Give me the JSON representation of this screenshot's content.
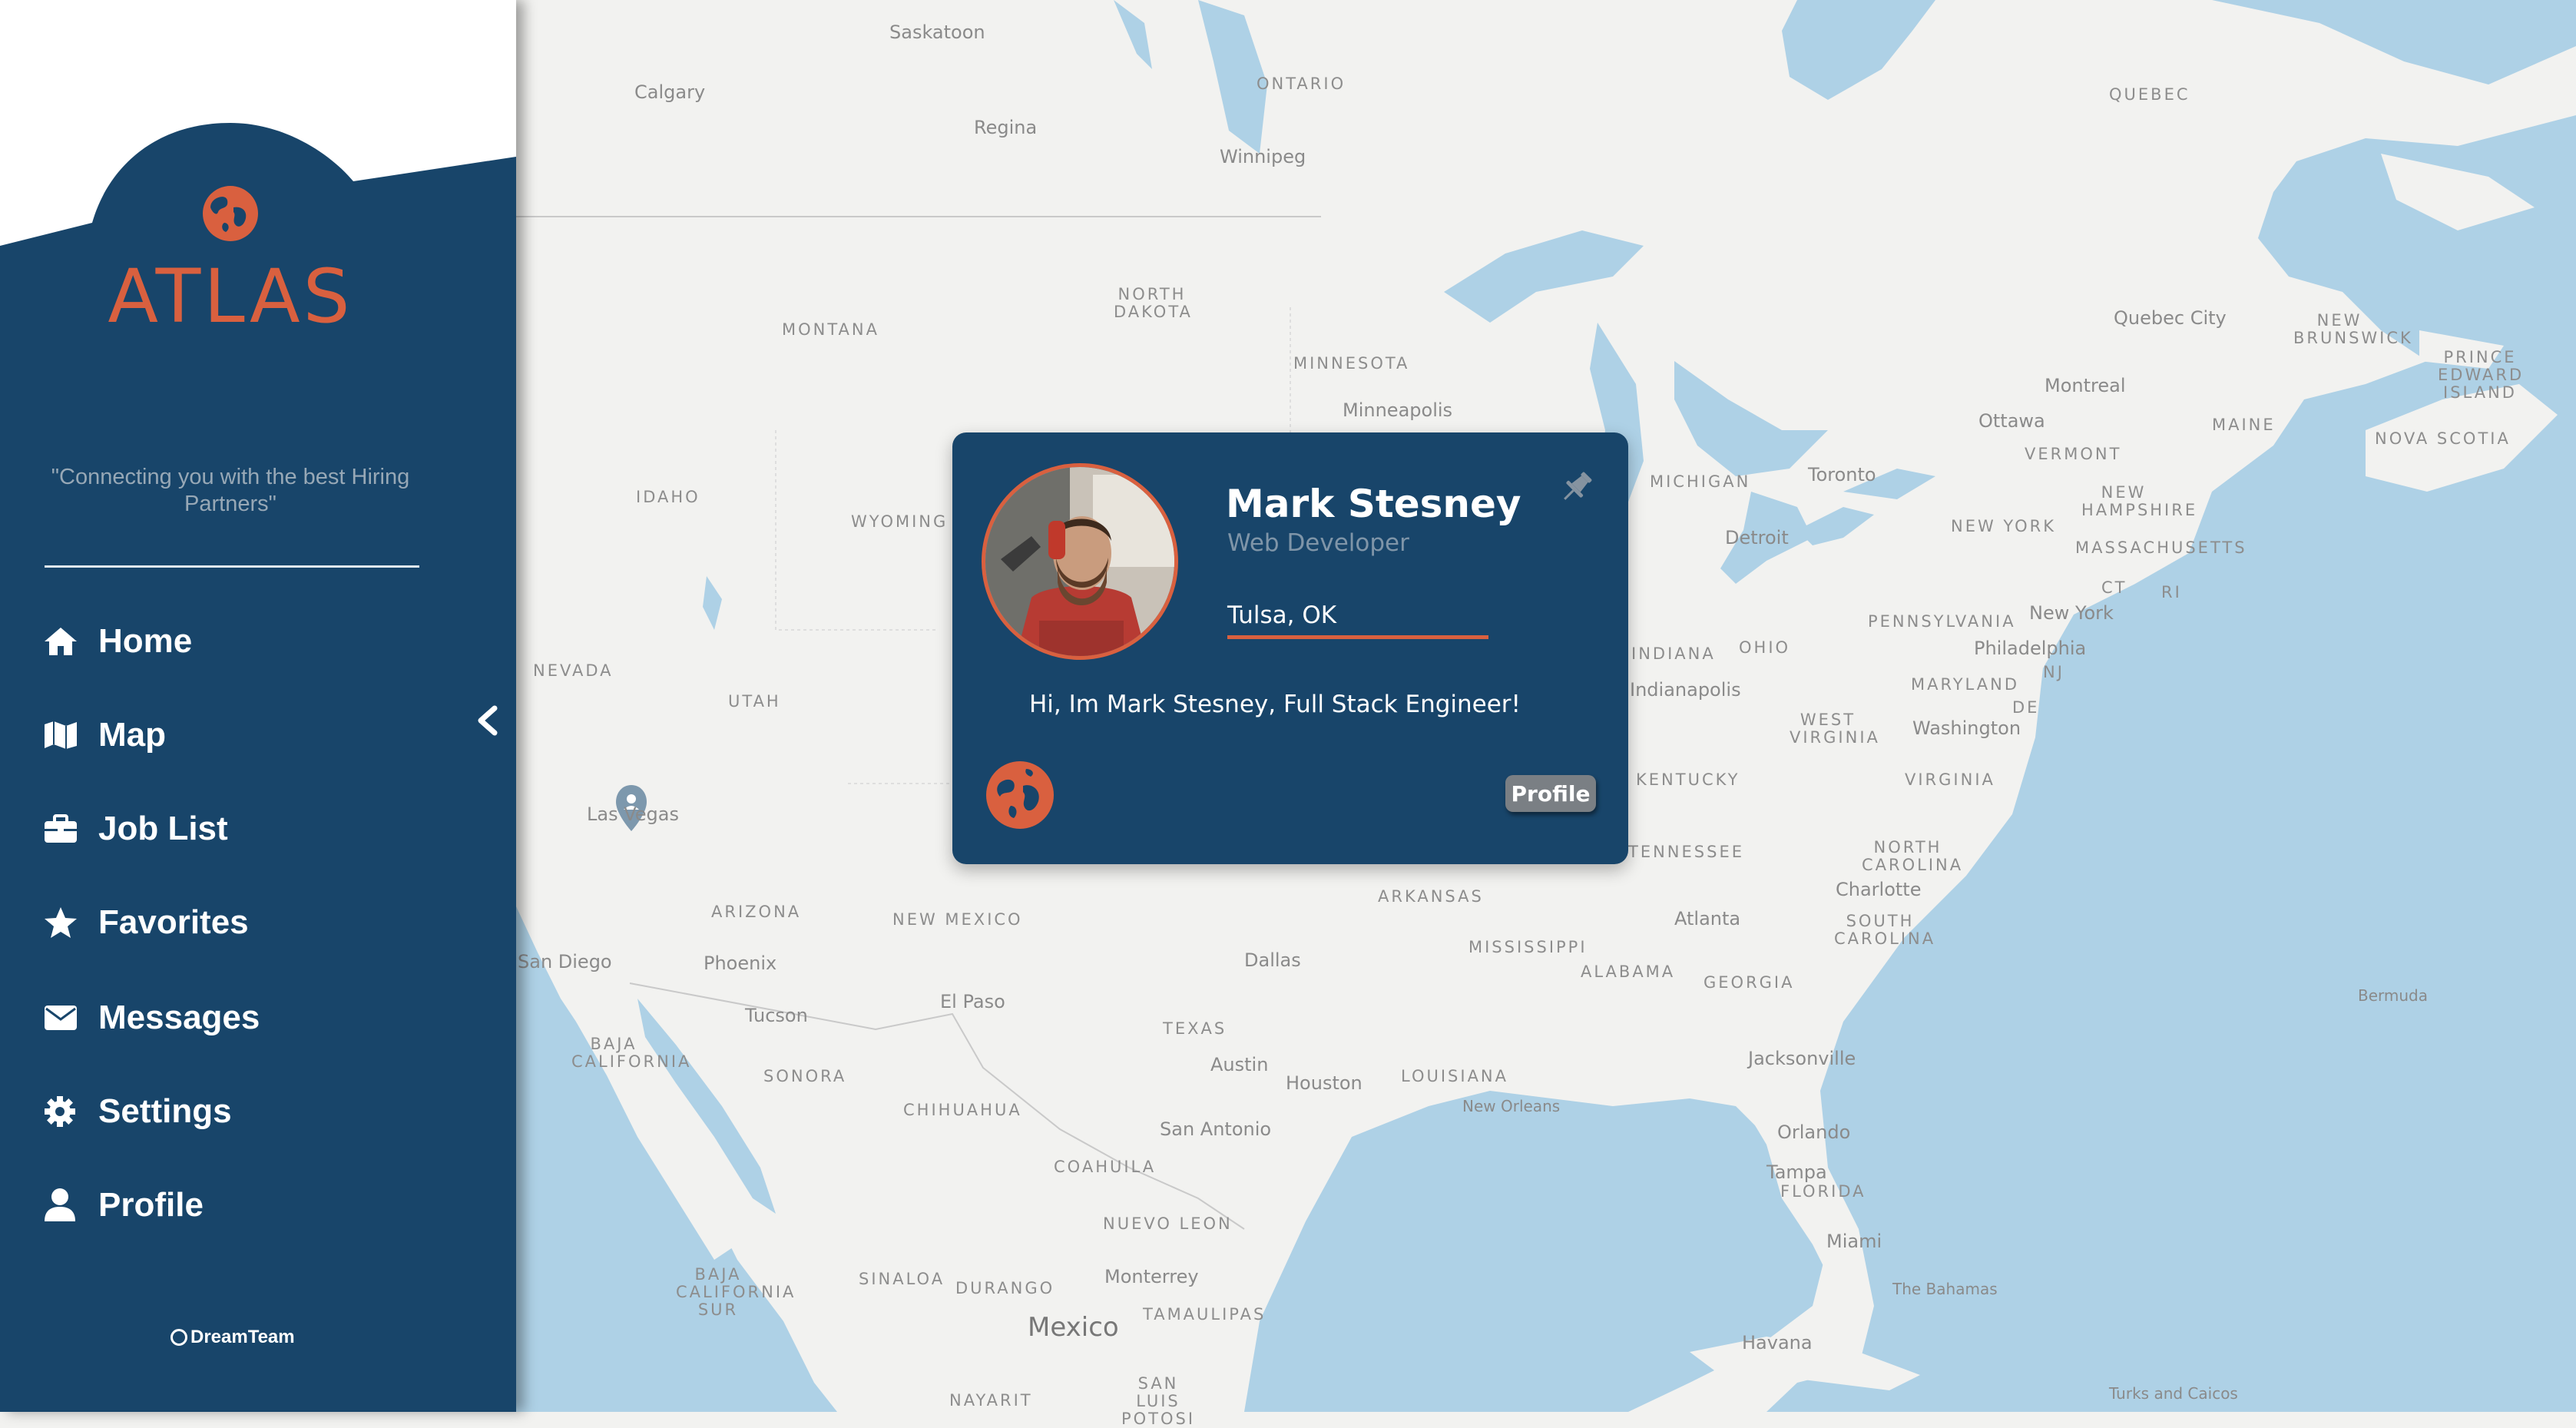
{
  "app": {
    "name": "ATLAS",
    "tagline": "\"Connecting you with the best Hiring Partners\"",
    "credit": "DreamTeam",
    "colors": {
      "sidebar": "#18456a",
      "accent": "#d9603f",
      "water": "#aed1e6",
      "land": "#f2f2f0"
    }
  },
  "nav": {
    "items": [
      {
        "label": "Home",
        "icon": "home-icon"
      },
      {
        "label": "Map",
        "icon": "map-icon"
      },
      {
        "label": "Job List",
        "icon": "briefcase-icon"
      },
      {
        "label": "Favorites",
        "icon": "star-icon"
      },
      {
        "label": "Messages",
        "icon": "envelope-icon"
      },
      {
        "label": "Settings",
        "icon": "gear-icon"
      },
      {
        "label": "Profile",
        "icon": "user-icon"
      }
    ]
  },
  "card": {
    "name": "Mark Stesney",
    "role": "Web Developer",
    "location": "Tulsa, OK",
    "bio": "Hi, Im Mark Stesney, Full Stack Engineer!",
    "profile_button": "Profile"
  },
  "map": {
    "marker_city": "Las Vegas",
    "states": [
      "MONTANA",
      "NORTH DAKOTA",
      "MINNESOTA",
      "IDAHO",
      "WYOMING",
      "NEVADA",
      "UTAH",
      "ARIZONA",
      "NEW MEXICO",
      "TEXAS",
      "ARKANSAS",
      "MISSISSIPPI",
      "ALABAMA",
      "GEORGIA",
      "LOUISIANA",
      "KENTUCKY",
      "VIRGINIA",
      "WEST VIRGINIA",
      "NORTH CAROLINA",
      "SOUTH CAROLINA",
      "FLORIDA",
      "OHIO",
      "MICHIGAN",
      "INDIANA",
      "TENNESSEE",
      "PENNSYLVANIA",
      "NEW YORK",
      "VERMONT",
      "NEW HAMPSHIRE",
      "MASSACHUSETTS",
      "MAINE",
      "MARYLAND",
      "ONTARIO",
      "QUEBEC",
      "NEW BRUNSWICK",
      "PRINCE EDWARD ISLAND",
      "NOVA SCOTIA",
      "BAJA CALIFORNIA",
      "BAJA CALIFORNIA SUR",
      "SONORA",
      "CHIHUAHUA",
      "COAHUILA",
      "NUEVO LEON",
      "SINALOA",
      "DURANGO",
      "TAMAULIPAS",
      "SAN LUIS POTOSI",
      "NAYARIT",
      "CT",
      "RI",
      "NJ",
      "DE"
    ],
    "cities": [
      "Saskatoon",
      "Calgary",
      "Regina",
      "Winnipeg",
      "Minneapolis",
      "Toronto",
      "Detroit",
      "Ottawa",
      "Montreal",
      "Quebec City",
      "New York",
      "Philadelphia",
      "Washington",
      "Charlotte",
      "Atlanta",
      "Jacksonville",
      "Orlando",
      "Tampa",
      "Miami",
      "Dallas",
      "Austin",
      "Houston",
      "San Antonio",
      "New Orleans",
      "El Paso",
      "Phoenix",
      "Tucson",
      "San Diego",
      "Monterrey",
      "Havana",
      "Bermuda",
      "The Bahamas",
      "Turks and Caicos",
      "Indianapolis"
    ],
    "country": "Mexico"
  }
}
